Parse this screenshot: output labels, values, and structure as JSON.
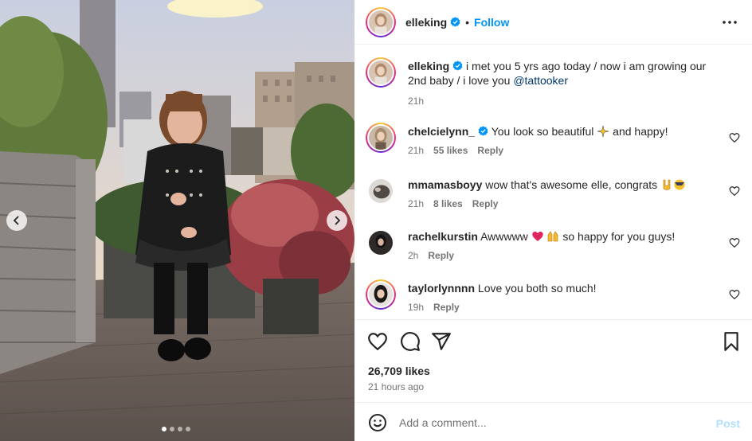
{
  "carousel": {
    "slide_count": 4,
    "active_slide": 1
  },
  "post": {
    "author": "elleking",
    "follow_label": "Follow",
    "caption_author": "elleking",
    "caption_text": "i met you 5 yrs ago today / now i am growing our 2nd baby / i love you",
    "caption_mention": "@tattooker",
    "caption_time": "21h",
    "likes_label": "26,709 likes",
    "time_ago": "21 hours ago"
  },
  "comments": [
    {
      "username": "chelcielynn_",
      "verified": true,
      "text_before": "You look so beautiful",
      "text_after": "and happy!",
      "time": "21h",
      "likes": "55 likes",
      "reply": "Reply"
    },
    {
      "username": "mmamasboyy",
      "verified": false,
      "text_before": "wow that's awesome elle, congrats",
      "text_after": "",
      "time": "21h",
      "likes": "8 likes",
      "reply": "Reply"
    },
    {
      "username": "rachelkurstin",
      "verified": false,
      "text_before": "Awwwww",
      "text_after": "so happy for you guys!",
      "time": "2h",
      "likes": "",
      "reply": "Reply"
    },
    {
      "username": "taylorlynnnn",
      "verified": false,
      "text_before": "Love you both so much!",
      "text_after": "",
      "time": "19h",
      "likes": "",
      "reply": "Reply"
    }
  ],
  "add_comment": {
    "placeholder": "Add a comment...",
    "post_label": "Post"
  },
  "icons": {
    "verified": "verified-badge-icon",
    "more": "more-options-icon",
    "like": "heart-icon",
    "comment": "comment-icon",
    "share": "share-icon",
    "save": "bookmark-icon",
    "emoji": "smiley-icon"
  },
  "colors": {
    "link_blue": "#0095f6",
    "mention": "#00376b",
    "muted": "#737373",
    "post_disabled": "#b2dffc"
  }
}
